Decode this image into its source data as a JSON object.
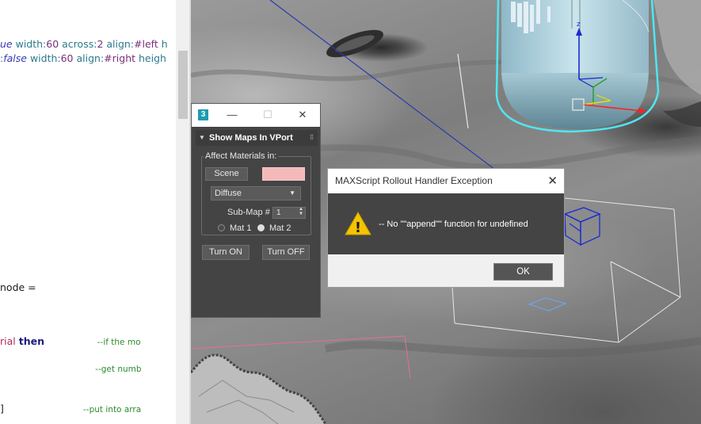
{
  "editor": {
    "lines": [
      {
        "parts": [
          {
            "t": "ue",
            "c": "#3b3bb4",
            "i": true
          },
          {
            "t": " width:",
            "c": "#2c7a8c"
          },
          {
            "t": "60",
            "c": "#7a2f7a"
          },
          {
            "t": " across:",
            "c": "#2c7a8c"
          },
          {
            "t": "2",
            "c": "#7a2f7a"
          },
          {
            "t": " align:",
            "c": "#2c7a8c"
          },
          {
            "t": "#left",
            "c": "#7a2f7a"
          },
          {
            "t": " h",
            "c": "#2c7a8c"
          }
        ]
      },
      {
        "parts": [
          {
            "t": ":",
            "c": "#2c7a8c"
          },
          {
            "t": "false",
            "c": "#3b3bb4",
            "i": true
          },
          {
            "t": " width:",
            "c": "#2c7a8c"
          },
          {
            "t": "60",
            "c": "#7a2f7a"
          },
          {
            "t": " align:",
            "c": "#2c7a8c"
          },
          {
            "t": "#right",
            "c": "#7a2f7a"
          },
          {
            "t": " heigh",
            "c": "#2c7a8c"
          }
        ]
      },
      {
        "parts": [
          {
            "t": "node =",
            "c": "#1a1a1a"
          }
        ]
      },
      {
        "parts": [
          {
            "t": "rial ",
            "c": "#b02a5a"
          },
          {
            "t": "then",
            "c": "#1b1b7e",
            "b": true
          },
          {
            "t": "                    --if the mo",
            "c": "#2e8b2e",
            "s": true
          }
        ]
      },
      {
        "parts": [
          {
            "t": "                                    --get numb",
            "c": "#2e8b2e",
            "s": true
          }
        ]
      },
      {
        "parts": [
          {
            "t": "]",
            "c": "#1a1a1a"
          },
          {
            "t": "                              --put into arra",
            "c": "#2e8b2e",
            "s": true
          }
        ]
      }
    ]
  },
  "tool_window": {
    "app_icon": "3",
    "minimize_icon": "—",
    "maximize_icon": "☐",
    "close_icon": "✕",
    "rollout_title": "Show Maps In VPort",
    "rollout_arrow": "▼",
    "grip": "⁞⁞",
    "group_label": "Affect Materials in:",
    "scene_button": "Scene",
    "pink_button": "",
    "map_dropdown": "Diffuse",
    "dropdown_arrow": "▼",
    "submap_label": "Sub-Map #",
    "submap_value": "1",
    "spinner_arrows": "▲▼",
    "radio_mat1": "Mat 1",
    "radio_mat2": "Mat 2",
    "turn_on": "Turn ON",
    "turn_off": "Turn OFF"
  },
  "error_dialog": {
    "title": "MAXScript Rollout Handler Exception",
    "close_icon": "✕",
    "warning_icon_glyph": "!",
    "message": "-- No \"\"append\"\" function for undefined",
    "ok_label": "OK"
  },
  "colors": {
    "dialog_dark": "#444444",
    "selection_cyan": "#4fe6f0",
    "pink_button": "#f4b9b9",
    "warning_yellow": "#f5c400"
  }
}
